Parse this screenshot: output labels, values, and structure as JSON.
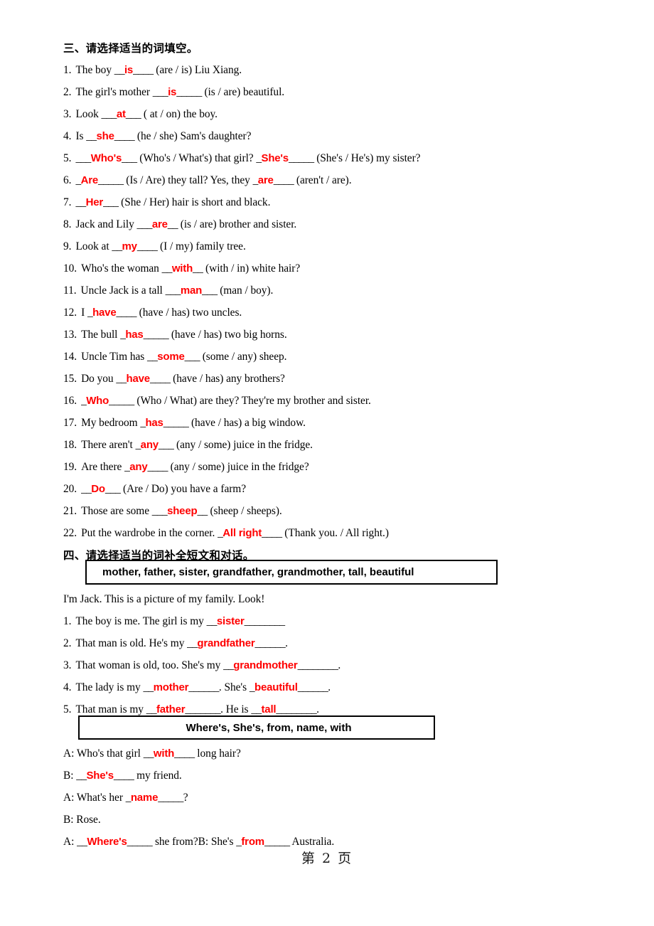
{
  "document": {
    "footer_page_label": "第  2  页"
  },
  "section3": {
    "heading": "三、请选择适当的词填空。",
    "items": [
      {
        "num": "1.",
        "pre": "The boy ",
        "b1": "__",
        "ans": "is",
        "b2": "____",
        "post": " (are / is) Liu Xiang."
      },
      {
        "num": "2.",
        "pre": "The girl's mother ",
        "b1": "___",
        "ans": "is",
        "b2": "_____",
        "post": " (is / are) beautiful."
      },
      {
        "num": "3.",
        "pre": "Look ",
        "b1": "___",
        "ans": "at",
        "b2": "___",
        "post": " ( at / on) the boy."
      },
      {
        "num": "4.",
        "pre": "Is ",
        "b1": "__",
        "ans": "she",
        "b2": "____",
        "post": " (he / she) Sam's daughter?"
      },
      {
        "num": "5.",
        "pre": "",
        "b1": "___",
        "ans": "Who's",
        "b2": "___",
        "post": " (Who's / What's) that girl?",
        "pre2": " ",
        "b3": "_",
        "ans2": "She's",
        "b4": "_____",
        "post2": " (She's / He's) my sister?"
      },
      {
        "num": "6.",
        "pre": "",
        "b1": "_",
        "ans": "Are",
        "b2": "_____",
        "post": " (Is / Are) they tall? Yes, they",
        "pre2": " ",
        "b3": "_",
        "ans2": "are",
        "b4": "____",
        "post2": " (aren't / are)."
      },
      {
        "num": "7.",
        "pre": "",
        "b1": "__",
        "ans": "Her",
        "b2": "___",
        "post": " (She / Her) hair is short and black."
      },
      {
        "num": "8.",
        "pre": "Jack and Lily ",
        "b1": "___",
        "ans": "are",
        "b2": "__",
        "post": " (is / are) brother and sister."
      },
      {
        "num": "9.",
        "pre": "Look at ",
        "b1": "__",
        "ans": "my",
        "b2": "____",
        "post": " (I / my) family tree."
      },
      {
        "num": "10.",
        "pre": "Who's the woman ",
        "b1": "__",
        "ans": "with",
        "b2": "__",
        "post": " (with / in) white hair?"
      },
      {
        "num": "11.",
        "pre": "Uncle Jack is a tall ",
        "b1": "___",
        "ans": "man",
        "b2": "___",
        "post": " (man / boy)."
      },
      {
        "num": "12.",
        "pre": "I ",
        "b1": "_",
        "ans": "have",
        "b2": "____",
        "post": " (have / has) two uncles."
      },
      {
        "num": "13.",
        "pre": "The bull ",
        "b1": "_",
        "ans": "has",
        "b2": "_____",
        "post": " (have / has) two big horns."
      },
      {
        "num": "14.",
        "pre": "Uncle Tim has ",
        "b1": "__",
        "ans": "some",
        "b2": "___",
        "post": " (some / any) sheep."
      },
      {
        "num": "15.",
        "pre": "Do you ",
        "b1": "__",
        "ans": "have",
        "b2": "____",
        "post": " (have / has) any brothers?"
      },
      {
        "num": "16.",
        "pre": "",
        "b1": "_",
        "ans": "Who",
        "b2": "_____",
        "post": " (Who / What) are they? They're my brother and sister."
      },
      {
        "num": "17.",
        "pre": "My bedroom ",
        "b1": "_",
        "ans": "has",
        "b2": "_____",
        "post": " (have / has) a big window."
      },
      {
        "num": "18.",
        "pre": "There aren't ",
        "b1": "_",
        "ans": "any",
        "b2": "___",
        "post": " (any / some) juice in the fridge."
      },
      {
        "num": "19.",
        "pre": "Are there ",
        "b1": "_",
        "ans": "any",
        "b2": "____",
        "post": " (any / some) juice in the fridge?"
      },
      {
        "num": "20.",
        "pre": "",
        "b1": "__",
        "ans": "Do",
        "b2": "___",
        "post": " (Are / Do) you have a farm?"
      },
      {
        "num": "21.",
        "pre": "Those are some ",
        "b1": "___",
        "ans": "sheep",
        "b2": "__",
        "post": " (sheep / sheeps)."
      },
      {
        "num": "22.",
        "pre": "Put the wardrobe in the corner. ",
        "b1": "_",
        "ans": "All right",
        "b2": "____",
        "post": " (Thank you. / All right.)"
      }
    ]
  },
  "section4": {
    "heading": "四、请选择适当的词补全短文和对话。",
    "wordbank1": "mother,   father,   sister,   grandfather,   grandmother,   tall,   beautiful",
    "intro": "I'm Jack. This is a picture of my family. Look!",
    "passage_items": [
      {
        "num": "1.",
        "pre": "The boy is me. The girl is my ",
        "b1": "__",
        "ans": "sister",
        "b2": "________",
        "post": ""
      },
      {
        "num": "2.",
        "pre": "That man is old. He's my ",
        "b1": "__",
        "ans": "grandfather",
        "b2": "______",
        "post": "."
      },
      {
        "num": "3.",
        "pre": "That woman is old, too. She's my ",
        "b1": "__",
        "ans": "grandmother",
        "b2": "________",
        "post": "."
      },
      {
        "num": "4.",
        "pre": "The lady is my ",
        "b1": "__",
        "ans": "mother",
        "b2": "______",
        "post": ". She's",
        "pre2": " ",
        "b3": "_",
        "ans2": "beautiful",
        "b4": "______",
        "post2": "."
      },
      {
        "num": "5.",
        "pre": "That man is my ",
        "b1": "__",
        "ans": "father",
        "b2": "_______",
        "post": ". He is",
        "pre2": " ",
        "b3": "__",
        "ans2": "tall",
        "b4": "________",
        "post2": "."
      }
    ],
    "wordbank2": "Where's,   She's,   from,   name,   with",
    "dialogue": [
      {
        "spk": "A:",
        "pre": " Who's that girl ",
        "b1": "__",
        "ans": "with",
        "b2": "____",
        "post": " long hair?"
      },
      {
        "spk": "B:",
        "pre": " ",
        "b1": "__",
        "ans": "She's",
        "b2": "____",
        "post": " my friend."
      },
      {
        "spk": "A:",
        "pre": " What's her ",
        "b1": "_",
        "ans": "name",
        "b2": "_____",
        "post": "?"
      },
      {
        "spk": "B:",
        "pre": " Rose.",
        "b1": "",
        "ans": "",
        "b2": "",
        "post": ""
      },
      {
        "spk": "A:",
        "pre": " ",
        "b1": "__",
        "ans": "Where's",
        "b2": "_____",
        "post": " she from?B: She's",
        "pre2": " ",
        "b3": "_",
        "ans2": "from",
        "b4": "_____",
        "post2": " Australia."
      }
    ]
  }
}
